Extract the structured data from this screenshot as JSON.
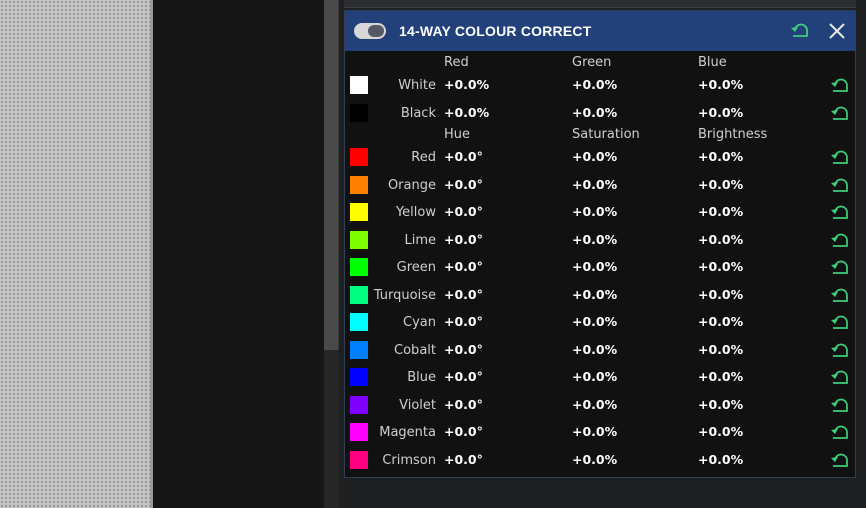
{
  "panel": {
    "title": "14-WAY COLOUR CORRECT",
    "enabled": true
  },
  "colors": {
    "header_bg": "#22407a",
    "reset_icon": "#3fcf7a"
  },
  "rgb_headers": [
    "Red",
    "Green",
    "Blue"
  ],
  "hsb_headers": [
    "Hue",
    "Saturation",
    "Brightness"
  ],
  "rgb_rows": [
    {
      "label": "White",
      "swatch": "#ffffff",
      "v1": "+0.0%",
      "v2": "+0.0%",
      "v3": "+0.0%"
    },
    {
      "label": "Black",
      "swatch": "#000000",
      "v1": "+0.0%",
      "v2": "+0.0%",
      "v3": "+0.0%"
    }
  ],
  "hsb_rows": [
    {
      "label": "Red",
      "swatch": "#ff0000",
      "v1": "+0.0°",
      "v2": "+0.0%",
      "v3": "+0.0%"
    },
    {
      "label": "Orange",
      "swatch": "#ff8000",
      "v1": "+0.0°",
      "v2": "+0.0%",
      "v3": "+0.0%"
    },
    {
      "label": "Yellow",
      "swatch": "#ffff00",
      "v1": "+0.0°",
      "v2": "+0.0%",
      "v3": "+0.0%"
    },
    {
      "label": "Lime",
      "swatch": "#80ff00",
      "v1": "+0.0°",
      "v2": "+0.0%",
      "v3": "+0.0%"
    },
    {
      "label": "Green",
      "swatch": "#00ff00",
      "v1": "+0.0°",
      "v2": "+0.0%",
      "v3": "+0.0%"
    },
    {
      "label": "Turquoise",
      "swatch": "#00ff80",
      "v1": "+0.0°",
      "v2": "+0.0%",
      "v3": "+0.0%"
    },
    {
      "label": "Cyan",
      "swatch": "#00ffff",
      "v1": "+0.0°",
      "v2": "+0.0%",
      "v3": "+0.0%"
    },
    {
      "label": "Cobalt",
      "swatch": "#0080ff",
      "v1": "+0.0°",
      "v2": "+0.0%",
      "v3": "+0.0%"
    },
    {
      "label": "Blue",
      "swatch": "#0000ff",
      "v1": "+0.0°",
      "v2": "+0.0%",
      "v3": "+0.0%"
    },
    {
      "label": "Violet",
      "swatch": "#8000ff",
      "v1": "+0.0°",
      "v2": "+0.0%",
      "v3": "+0.0%"
    },
    {
      "label": "Magenta",
      "swatch": "#ff00ff",
      "v1": "+0.0°",
      "v2": "+0.0%",
      "v3": "+0.0%"
    },
    {
      "label": "Crimson",
      "swatch": "#ff0080",
      "v1": "+0.0°",
      "v2": "+0.0%",
      "v3": "+0.0%"
    }
  ]
}
